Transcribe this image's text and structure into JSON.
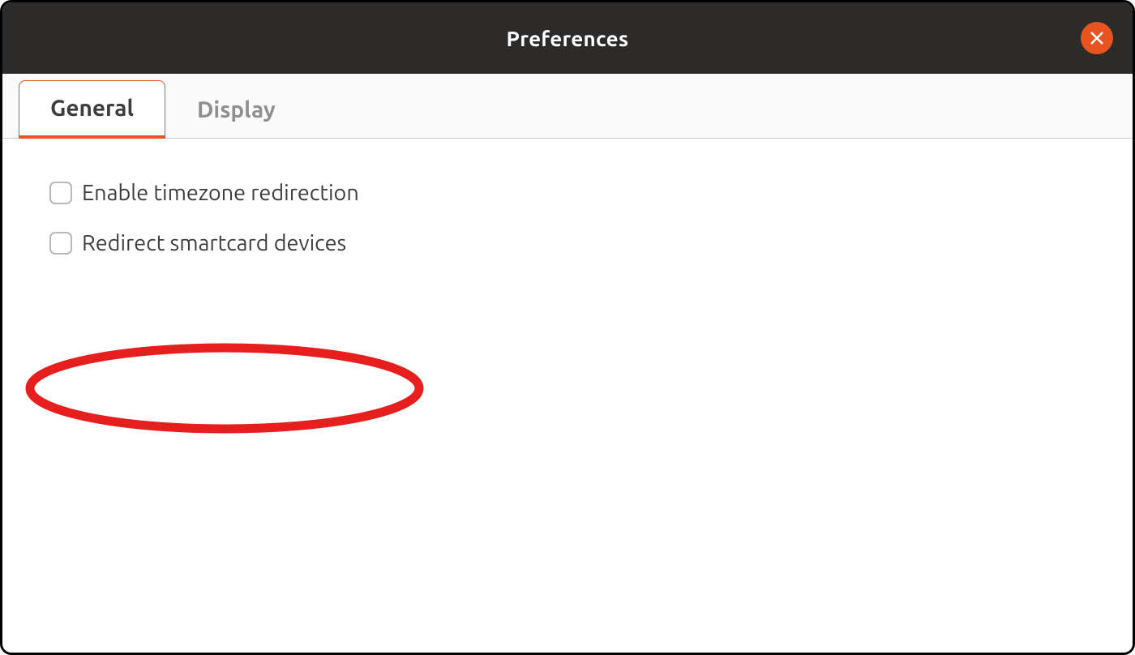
{
  "window": {
    "title": "Preferences"
  },
  "tabs": [
    {
      "label": "General",
      "active": true
    },
    {
      "label": "Display",
      "active": false
    }
  ],
  "options": [
    {
      "label": "Enable timezone redirection",
      "checked": false
    },
    {
      "label": "Redirect smartcard devices",
      "checked": false
    }
  ],
  "annotation": {
    "target_option_index": 1,
    "color": "#e61e1e"
  }
}
